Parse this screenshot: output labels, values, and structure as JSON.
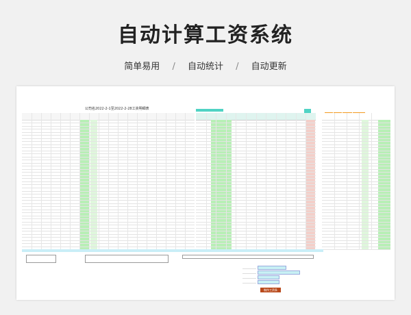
{
  "header": {
    "title": "自动计算工资系统",
    "features": [
      "简单易用",
      "自动统计",
      "自动更新"
    ],
    "separator": "/"
  },
  "sheet": {
    "caption": "公司名2022-2-1至2022-2-28工资明细表",
    "button_label": "制作工资条"
  },
  "colors": {
    "background": "#f1f1f1",
    "teal": "#4fd3c4",
    "green": "#b8efb6",
    "orange": "#f39a1f",
    "red_button": "#b94a1c"
  }
}
